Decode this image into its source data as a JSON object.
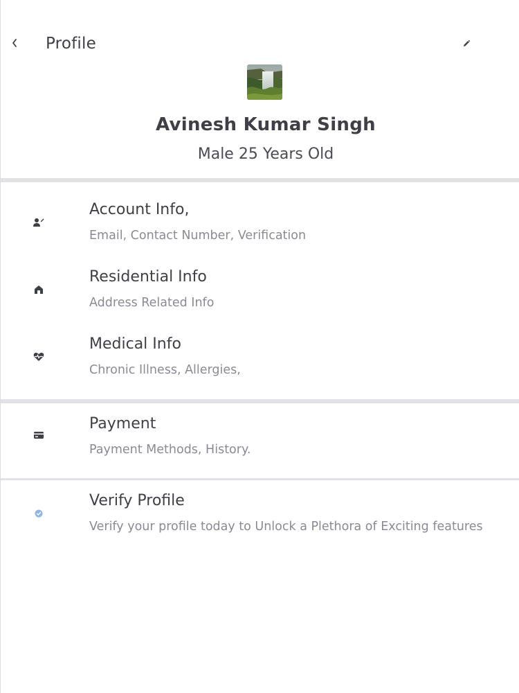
{
  "header": {
    "title": "Profile",
    "back_icon": "chevron-left-icon",
    "edit_icon": "pencil-icon"
  },
  "profile": {
    "name": "Avinesh Kumar Singh",
    "subtitle": "Male 25 Years Old",
    "avatar": "waterfall-landscape-photo"
  },
  "menu": [
    {
      "title": "Account Info,",
      "subtitle": "Email, Contact Number, Verification",
      "icon": "user-edit-icon"
    },
    {
      "title": "Residential Info",
      "subtitle": "Address Related Info",
      "icon": "home-icon"
    },
    {
      "title": "Medical Info",
      "subtitle": "Chronic Illness, Allergies,",
      "icon": "heart-pulse-icon"
    },
    {
      "title": "Payment",
      "subtitle": "Payment Methods, History.",
      "icon": "credit-card-icon"
    },
    {
      "title": "Verify Profile",
      "subtitle": "Verify your profile today to Unlock a Plethora of Exciting features",
      "icon": "verified-badge-icon"
    }
  ],
  "colors": {
    "text_primary": "#3f3f46",
    "text_secondary": "#8a8a92",
    "divider": "#e2e2e6",
    "verify_accent": "#8fb4e8"
  }
}
